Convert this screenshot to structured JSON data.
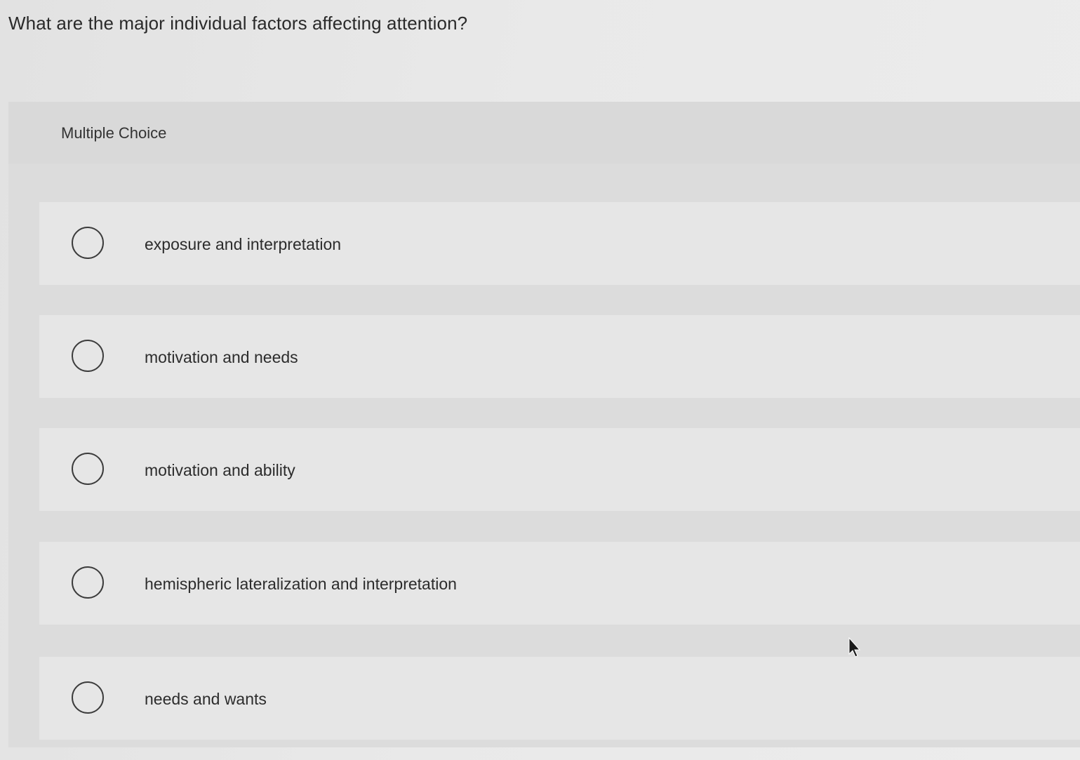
{
  "question": {
    "text": "What are the major individual factors affecting attention?"
  },
  "panel": {
    "type_label": "Multiple Choice"
  },
  "options": [
    {
      "label": "exposure and interpretation",
      "selected": false
    },
    {
      "label": "motivation and needs",
      "selected": false
    },
    {
      "label": "motivation and ability",
      "selected": false
    },
    {
      "label": "hemispheric lateralization and interpretation",
      "selected": false
    },
    {
      "label": "needs and wants",
      "selected": false
    }
  ],
  "cursor": {
    "icon": "mouse-pointer-icon"
  }
}
